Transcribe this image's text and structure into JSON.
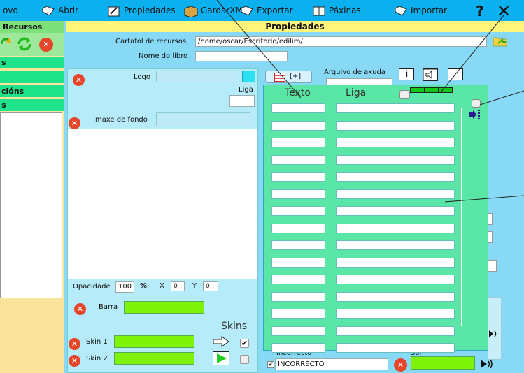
{
  "menubar": {
    "items": [
      {
        "label": "ovo"
      },
      {
        "label": "Abrir"
      },
      {
        "label": "Propiedades"
      },
      {
        "label": "GardarXML"
      },
      {
        "label": "Exportar"
      },
      {
        "label": "Páxinas"
      },
      {
        "label": "Importar"
      }
    ]
  },
  "left": {
    "header": "Recursos",
    "bars": [
      "s",
      "",
      "cións",
      "s"
    ]
  },
  "props": {
    "title": "Propiedades",
    "cartafol_label": "Cartafol de recursos",
    "cartafol_value": "/home/oscar/Escritorio/edilim/",
    "nome_label": "Nome do libro",
    "nome_value": ""
  },
  "mid": {
    "logo_label": "Logo",
    "liga_label": "Liga",
    "imaxe_label": "Imaxe de fondo",
    "opacidade_label": "Opacidade",
    "opacidade_value": "100",
    "percent_symbol": "%",
    "x_label": "X",
    "x_value": "0",
    "y_label": "Y",
    "y_value": "0",
    "barra_label": "Barra",
    "skins_label": "Skins",
    "skin1_label": "Skin 1",
    "skin2_label": "Skin 2"
  },
  "right": {
    "plus_label": "[+]",
    "arquivo_label": "Arquivo de axuda",
    "info_glyph": "i",
    "incorrecto_label": "Incorrecto",
    "incorrecto_value": "INCORRECTO",
    "son_label": "Son"
  },
  "linkwin": {
    "col_texto": "Texto",
    "col_liga": "Liga"
  },
  "colors": {
    "menubar": "#0db0ef",
    "accent_yellow": "#fff57a",
    "link_panel": "#59e6a7",
    "green_field": "#7ff20a",
    "close_red": "#e5462a"
  }
}
